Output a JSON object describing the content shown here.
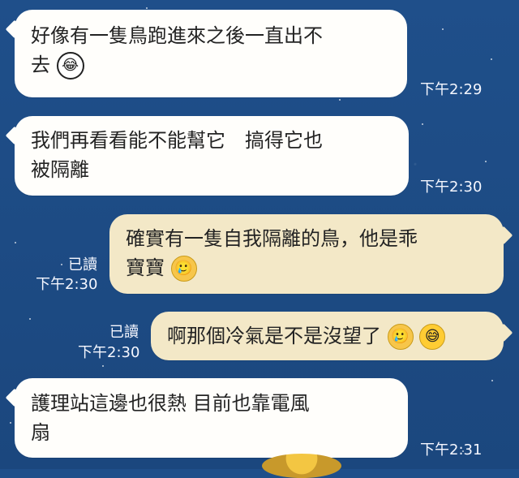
{
  "messages": [
    {
      "direction": "in",
      "lines": [
        "好像有一隻鳥跑進來之後一直出不",
        "去"
      ],
      "emoji": [
        "laughing-crying-emoji"
      ],
      "time": "下午2:29"
    },
    {
      "direction": "in",
      "lines": [
        "我們再看看能不能幫它　搞得它也",
        "被隔離"
      ],
      "time": "下午2:30"
    },
    {
      "direction": "out",
      "lines": [
        "確實有一隻自我隔離的鳥，他是乖",
        "寶寶"
      ],
      "emoji": [
        "tearful-smile-emoji"
      ],
      "read": "已讀",
      "time": "下午2:30"
    },
    {
      "direction": "out",
      "lines": [
        "啊那個冷氣是不是沒望了"
      ],
      "emoji": [
        "tearful-smile-emoji",
        "grin-sweat-emoji"
      ],
      "read": "已讀",
      "time": "下午2:30"
    },
    {
      "direction": "in",
      "lines": [
        "護理站這邊也很熱 目前也靠電風",
        "扇"
      ],
      "time": "下午2:31"
    }
  ],
  "emoji_glyphs": {
    "laughing-crying-emoji": "😂",
    "tearful-smile-emoji": "🥲",
    "grin-sweat-emoji": "😅"
  },
  "colors": {
    "background": "#1f4f8a",
    "incoming_bubble": "#fffefb",
    "outgoing_bubble": "#f3e8c7",
    "meta_text": "#f5f7ff"
  }
}
